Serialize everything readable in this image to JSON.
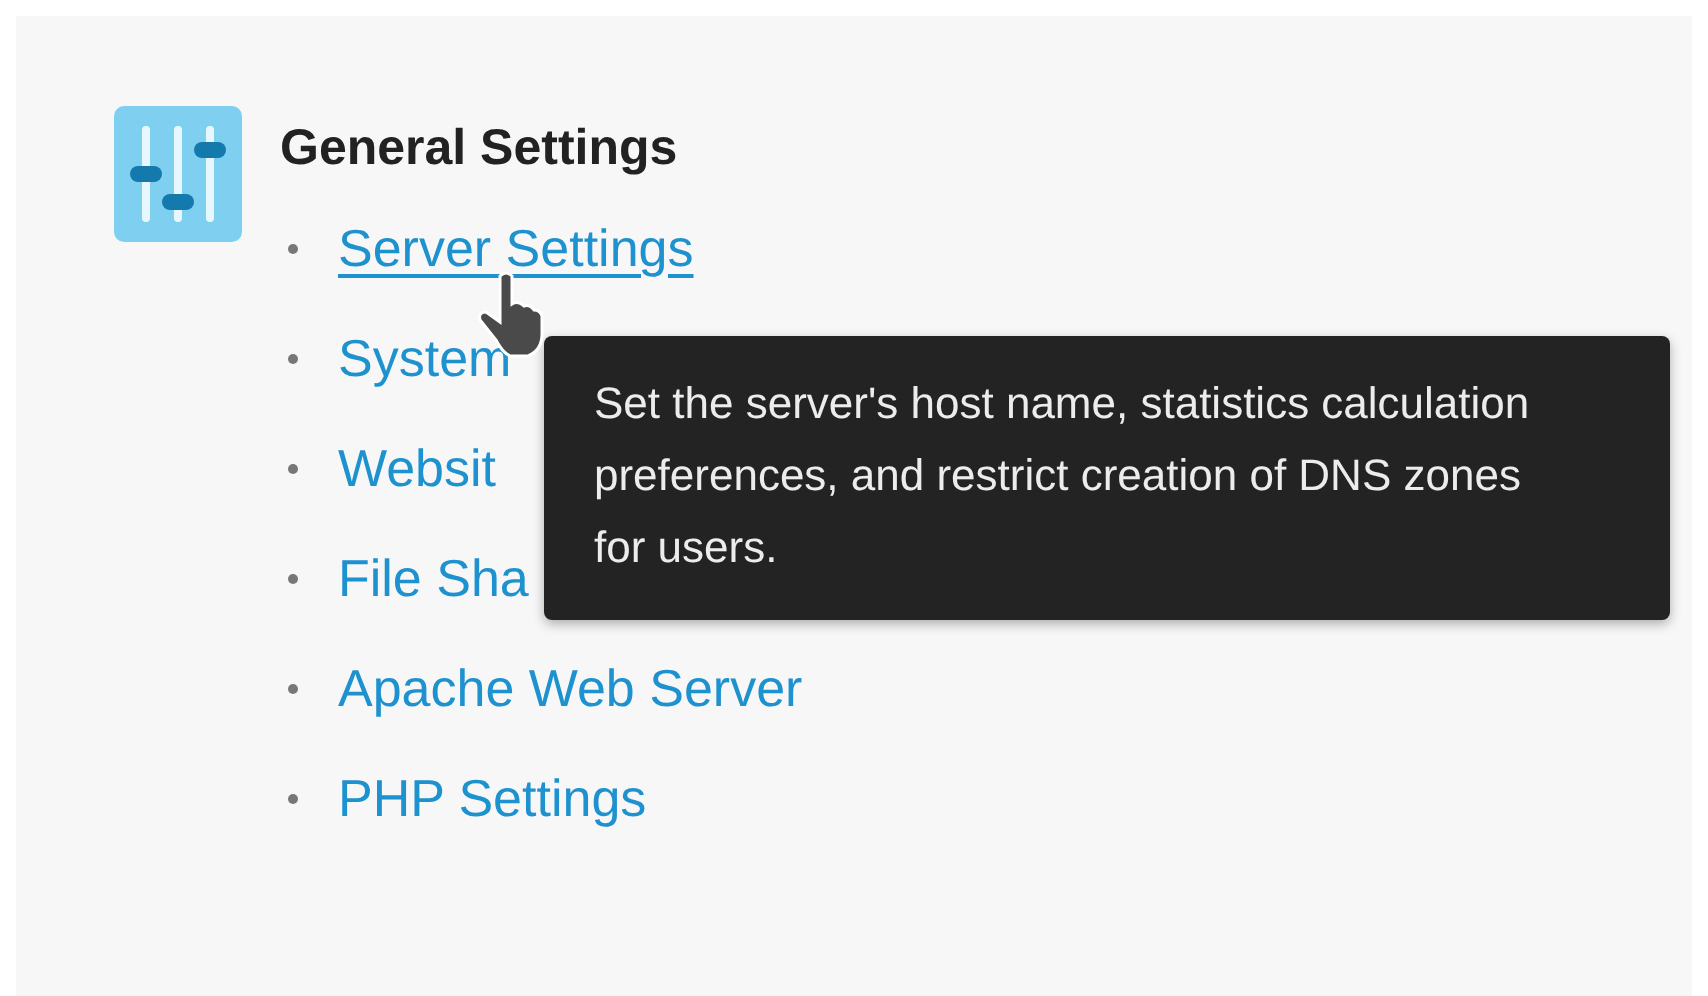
{
  "section": {
    "title": "General Settings"
  },
  "links": [
    {
      "label": "Server Settings",
      "hovered": true
    },
    {
      "label": "System",
      "hovered": false
    },
    {
      "label": "Websit",
      "hovered": false
    },
    {
      "label": "File Sha",
      "hovered": false
    },
    {
      "label": "Apache Web Server",
      "hovered": false
    },
    {
      "label": "PHP Settings",
      "hovered": false
    }
  ],
  "tooltip": {
    "text": "Set the server's host name, statistics calculation preferences, and restrict creation of DNS zones for users."
  }
}
